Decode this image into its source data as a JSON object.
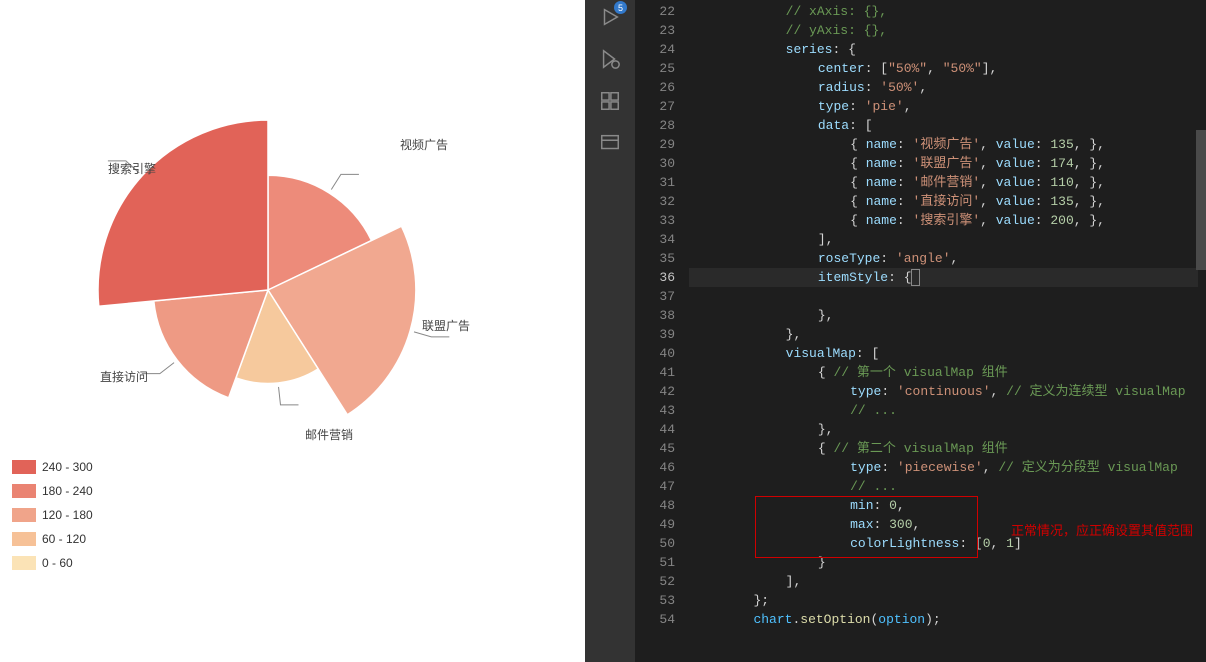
{
  "chart_data": {
    "type": "pie",
    "roseType": "angle",
    "series": [
      {
        "name": "视频广告",
        "value": 135,
        "color": "#ed8b7a"
      },
      {
        "name": "联盟广告",
        "value": 174,
        "color": "#f1a890"
      },
      {
        "name": "邮件营销",
        "value": 110,
        "color": "#f6c99d"
      },
      {
        "name": "直接访问",
        "value": 135,
        "color": "#ee9a84"
      },
      {
        "name": "搜索引擎",
        "value": 200,
        "color": "#e16358"
      }
    ],
    "visualMap": {
      "min": 0,
      "max": 300,
      "colorLightness": [
        0,
        1
      ]
    }
  },
  "labels": {
    "l0": "视频广告",
    "l1": "联盟广告",
    "l2": "邮件营销",
    "l3": "直接访问",
    "l4": "搜索引擎"
  },
  "legend": [
    {
      "label": "240 - 300",
      "color": "#e16358"
    },
    {
      "label": "180 - 240",
      "color": "#ea8372"
    },
    {
      "label": "120 - 180",
      "color": "#f0a48a"
    },
    {
      "label": "60 - 120",
      "color": "#f6c197"
    },
    {
      "label": "0 - 60",
      "color": "#fbe3b6"
    }
  ],
  "activity_badge": "5",
  "annotation": "正常情况，应正确设置其值范围",
  "code": {
    "start_line": 22,
    "current_line": 36,
    "lines": [
      {
        "t": [
          [
            "cm",
            "// xAxis: {},"
          ]
        ],
        "ind": 3
      },
      {
        "t": [
          [
            "cm",
            "// yAxis: {},"
          ]
        ],
        "ind": 3
      },
      {
        "t": [
          [
            "prop",
            "series"
          ],
          [
            "pun",
            ": {"
          ]
        ],
        "ind": 3
      },
      {
        "t": [
          [
            "prop",
            "center"
          ],
          [
            "pun",
            ": ["
          ],
          [
            "str",
            "\"50%\""
          ],
          [
            "pun",
            ", "
          ],
          [
            "str",
            "\"50%\""
          ],
          [
            "pun",
            "],"
          ]
        ],
        "ind": 4
      },
      {
        "t": [
          [
            "prop",
            "radius"
          ],
          [
            "pun",
            ": "
          ],
          [
            "str",
            "'50%'"
          ],
          [
            "pun",
            ","
          ]
        ],
        "ind": 4
      },
      {
        "t": [
          [
            "prop",
            "type"
          ],
          [
            "pun",
            ": "
          ],
          [
            "str",
            "'pie'"
          ],
          [
            "pun",
            ","
          ]
        ],
        "ind": 4
      },
      {
        "t": [
          [
            "prop",
            "data"
          ],
          [
            "pun",
            ": ["
          ]
        ],
        "ind": 4
      },
      {
        "t": [
          [
            "pun",
            "{ "
          ],
          [
            "prop",
            "name"
          ],
          [
            "pun",
            ": "
          ],
          [
            "str",
            "'视频广告'"
          ],
          [
            "pun",
            ", "
          ],
          [
            "prop",
            "value"
          ],
          [
            "pun",
            ": "
          ],
          [
            "num",
            "135"
          ],
          [
            "pun",
            ", },"
          ]
        ],
        "ind": 5
      },
      {
        "t": [
          [
            "pun",
            "{ "
          ],
          [
            "prop",
            "name"
          ],
          [
            "pun",
            ": "
          ],
          [
            "str",
            "'联盟广告'"
          ],
          [
            "pun",
            ", "
          ],
          [
            "prop",
            "value"
          ],
          [
            "pun",
            ": "
          ],
          [
            "num",
            "174"
          ],
          [
            "pun",
            ", },"
          ]
        ],
        "ind": 5
      },
      {
        "t": [
          [
            "pun",
            "{ "
          ],
          [
            "prop",
            "name"
          ],
          [
            "pun",
            ": "
          ],
          [
            "str",
            "'邮件营销'"
          ],
          [
            "pun",
            ", "
          ],
          [
            "prop",
            "value"
          ],
          [
            "pun",
            ": "
          ],
          [
            "num",
            "110"
          ],
          [
            "pun",
            ", },"
          ]
        ],
        "ind": 5
      },
      {
        "t": [
          [
            "pun",
            "{ "
          ],
          [
            "prop",
            "name"
          ],
          [
            "pun",
            ": "
          ],
          [
            "str",
            "'直接访问'"
          ],
          [
            "pun",
            ", "
          ],
          [
            "prop",
            "value"
          ],
          [
            "pun",
            ": "
          ],
          [
            "num",
            "135"
          ],
          [
            "pun",
            ", },"
          ]
        ],
        "ind": 5
      },
      {
        "t": [
          [
            "pun",
            "{ "
          ],
          [
            "prop",
            "name"
          ],
          [
            "pun",
            ": "
          ],
          [
            "str",
            "'搜索引擎'"
          ],
          [
            "pun",
            ", "
          ],
          [
            "prop",
            "value"
          ],
          [
            "pun",
            ": "
          ],
          [
            "num",
            "200"
          ],
          [
            "pun",
            ", },"
          ]
        ],
        "ind": 5
      },
      {
        "t": [
          [
            "pun",
            "],"
          ]
        ],
        "ind": 4
      },
      {
        "t": [
          [
            "prop",
            "roseType"
          ],
          [
            "pun",
            ": "
          ],
          [
            "str",
            "'angle'"
          ],
          [
            "pun",
            ","
          ]
        ],
        "ind": 4
      },
      {
        "t": [
          [
            "prop",
            "itemStyle"
          ],
          [
            "pun",
            ": {"
          ]
        ],
        "ind": 4,
        "current": true
      },
      {
        "t": [],
        "ind": 5
      },
      {
        "t": [
          [
            "pun",
            "},"
          ]
        ],
        "ind": 4
      },
      {
        "t": [
          [
            "pun",
            "},"
          ]
        ],
        "ind": 3
      },
      {
        "t": [
          [
            "prop",
            "visualMap"
          ],
          [
            "pun",
            ": ["
          ]
        ],
        "ind": 3
      },
      {
        "t": [
          [
            "pun",
            "{ "
          ],
          [
            "cm",
            "// 第一个 visualMap 组件"
          ]
        ],
        "ind": 4
      },
      {
        "t": [
          [
            "prop",
            "type"
          ],
          [
            "pun",
            ": "
          ],
          [
            "str",
            "'continuous'"
          ],
          [
            "pun",
            ", "
          ],
          [
            "cm",
            "// 定义为连续型 visualMap"
          ]
        ],
        "ind": 5
      },
      {
        "t": [
          [
            "cm",
            "// ..."
          ]
        ],
        "ind": 5
      },
      {
        "t": [
          [
            "pun",
            "},"
          ]
        ],
        "ind": 4
      },
      {
        "t": [
          [
            "pun",
            "{ "
          ],
          [
            "cm",
            "// 第二个 visualMap 组件"
          ]
        ],
        "ind": 4
      },
      {
        "t": [
          [
            "prop",
            "type"
          ],
          [
            "pun",
            ": "
          ],
          [
            "str",
            "'piecewise'"
          ],
          [
            "pun",
            ", "
          ],
          [
            "cm",
            "// 定义为分段型 visualMap"
          ]
        ],
        "ind": 5
      },
      {
        "t": [
          [
            "cm",
            "// ..."
          ]
        ],
        "ind": 5
      },
      {
        "t": [
          [
            "prop",
            "min"
          ],
          [
            "pun",
            ": "
          ],
          [
            "num",
            "0"
          ],
          [
            "pun",
            ","
          ]
        ],
        "ind": 5
      },
      {
        "t": [
          [
            "prop",
            "max"
          ],
          [
            "pun",
            ": "
          ],
          [
            "num",
            "300"
          ],
          [
            "pun",
            ","
          ]
        ],
        "ind": 5
      },
      {
        "t": [
          [
            "prop",
            "colorLightness"
          ],
          [
            "pun",
            ": ["
          ],
          [
            "num",
            "0"
          ],
          [
            "pun",
            ", "
          ],
          [
            "num",
            "1"
          ],
          [
            "pun",
            "]"
          ]
        ],
        "ind": 5
      },
      {
        "t": [
          [
            "pun",
            "}"
          ]
        ],
        "ind": 4
      },
      {
        "t": [
          [
            "pun",
            "],"
          ]
        ],
        "ind": 3
      },
      {
        "t": [
          [
            "pun",
            "};"
          ]
        ],
        "ind": 2
      },
      {
        "t": [
          [
            "id",
            "chart"
          ],
          [
            "pun",
            "."
          ],
          [
            "fn",
            "setOption"
          ],
          [
            "pun",
            "("
          ],
          [
            "id",
            "option"
          ],
          [
            "pun",
            ");"
          ]
        ],
        "ind": 2
      }
    ]
  }
}
